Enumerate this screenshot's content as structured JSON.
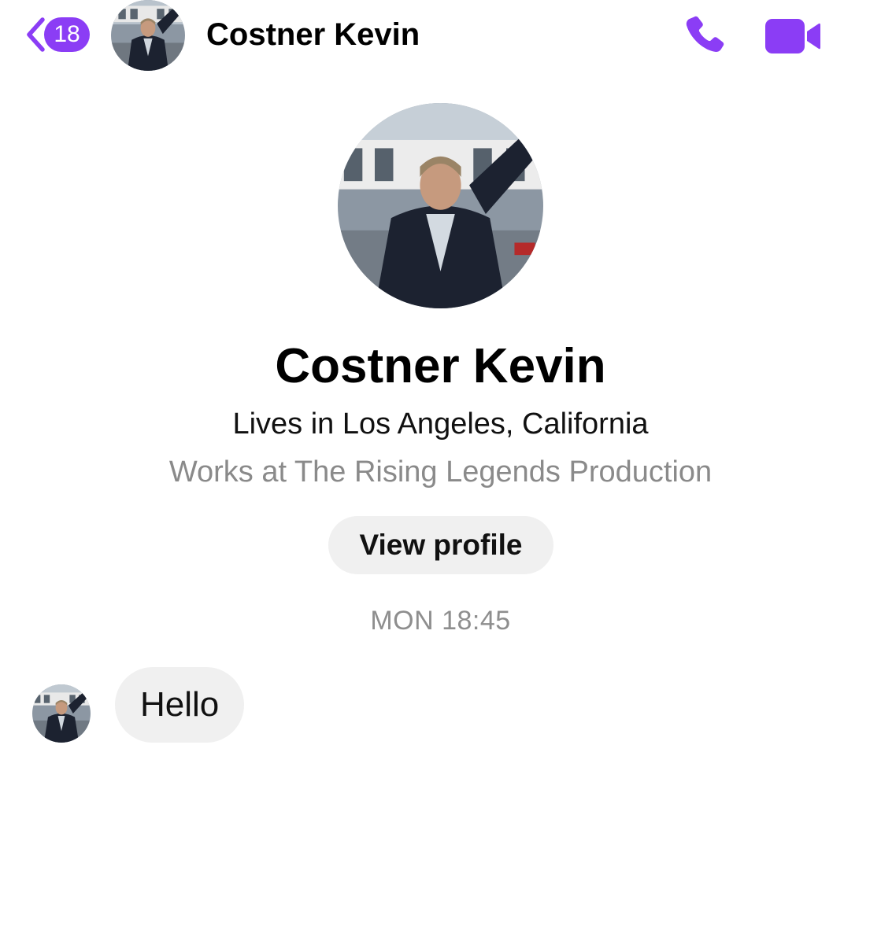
{
  "colors": {
    "accent": "#8b3df5",
    "bubble": "#f0f0f0",
    "muted_text": "#8a8a8a"
  },
  "header": {
    "back_icon": "chevron-left-icon",
    "unread_count": "18",
    "contact_name": "Costner Kevin",
    "call_icon": "phone-icon",
    "video_icon": "video-camera-icon"
  },
  "profile": {
    "name": "Costner Kevin",
    "location": "Lives in Los Angeles, California",
    "work": "Works at The Rising Legends Production",
    "view_profile_label": "View profile"
  },
  "conversation": {
    "timestamp": "MON 18:45",
    "messages": [
      {
        "sender": "Costner Kevin",
        "text": "Hello"
      }
    ]
  }
}
